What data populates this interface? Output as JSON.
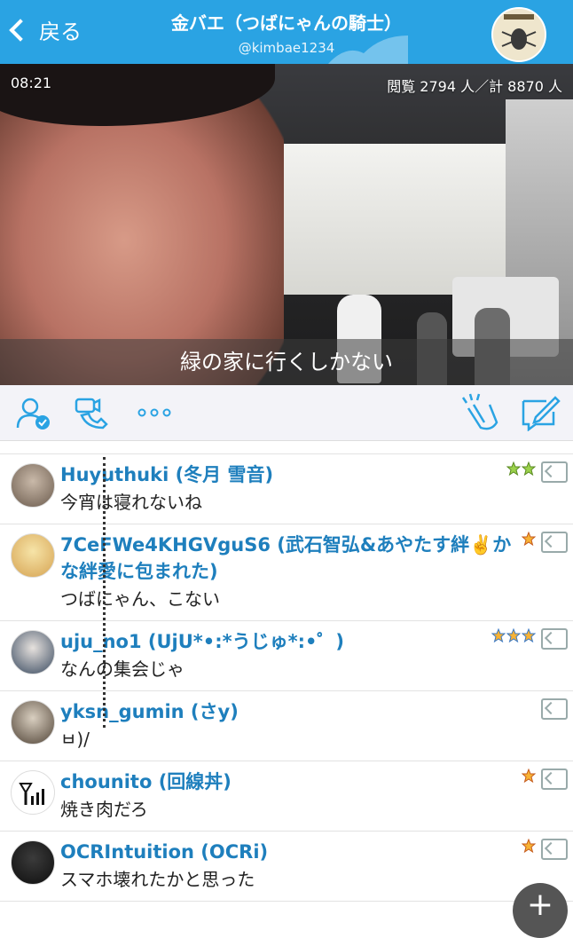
{
  "header": {
    "back_label": "戻る",
    "title": "金バエ（つばにゃんの騎士）",
    "handle": "@kimbae1234"
  },
  "video": {
    "time": "08:21",
    "views": "閲覧 2794 人／計 8870 人",
    "subtitle": "緑の家に行くしかない"
  },
  "toolbar": {
    "icons": [
      "user-check-icon",
      "video-call-icon",
      "more-icon",
      "clap-icon",
      "compose-icon"
    ]
  },
  "comments": [
    {
      "name": "Huyuthuki (冬月 雪音)",
      "text": "今宵は寝れないね",
      "badge_count": 2,
      "badge_color": "green"
    },
    {
      "name": "7CeFWe4KHGVguS6 (武石智弘&あやたす絆✌️かな絆愛に包まれた)",
      "text": "つばにゃん、こない",
      "badge_count": 1,
      "badge_color": "orange"
    },
    {
      "name": "uju_no1 (UjU*•:*うじゅ*:•゜)",
      "text": "なんの集会じゃ",
      "badge_count": 3,
      "badge_color": "blue"
    },
    {
      "name": "yksn_gumin (さy)",
      "text": "ㅂ)/",
      "badge_count": 0,
      "badge_color": ""
    },
    {
      "name": "chounito (回線丼)",
      "text": "焼き肉だろ",
      "badge_count": 1,
      "badge_color": "orange"
    },
    {
      "name": "OCRIntuition (OCRi)",
      "text": "スマホ壊れたかと思った",
      "badge_count": 1,
      "badge_color": "orange"
    }
  ],
  "fab_label": "+"
}
